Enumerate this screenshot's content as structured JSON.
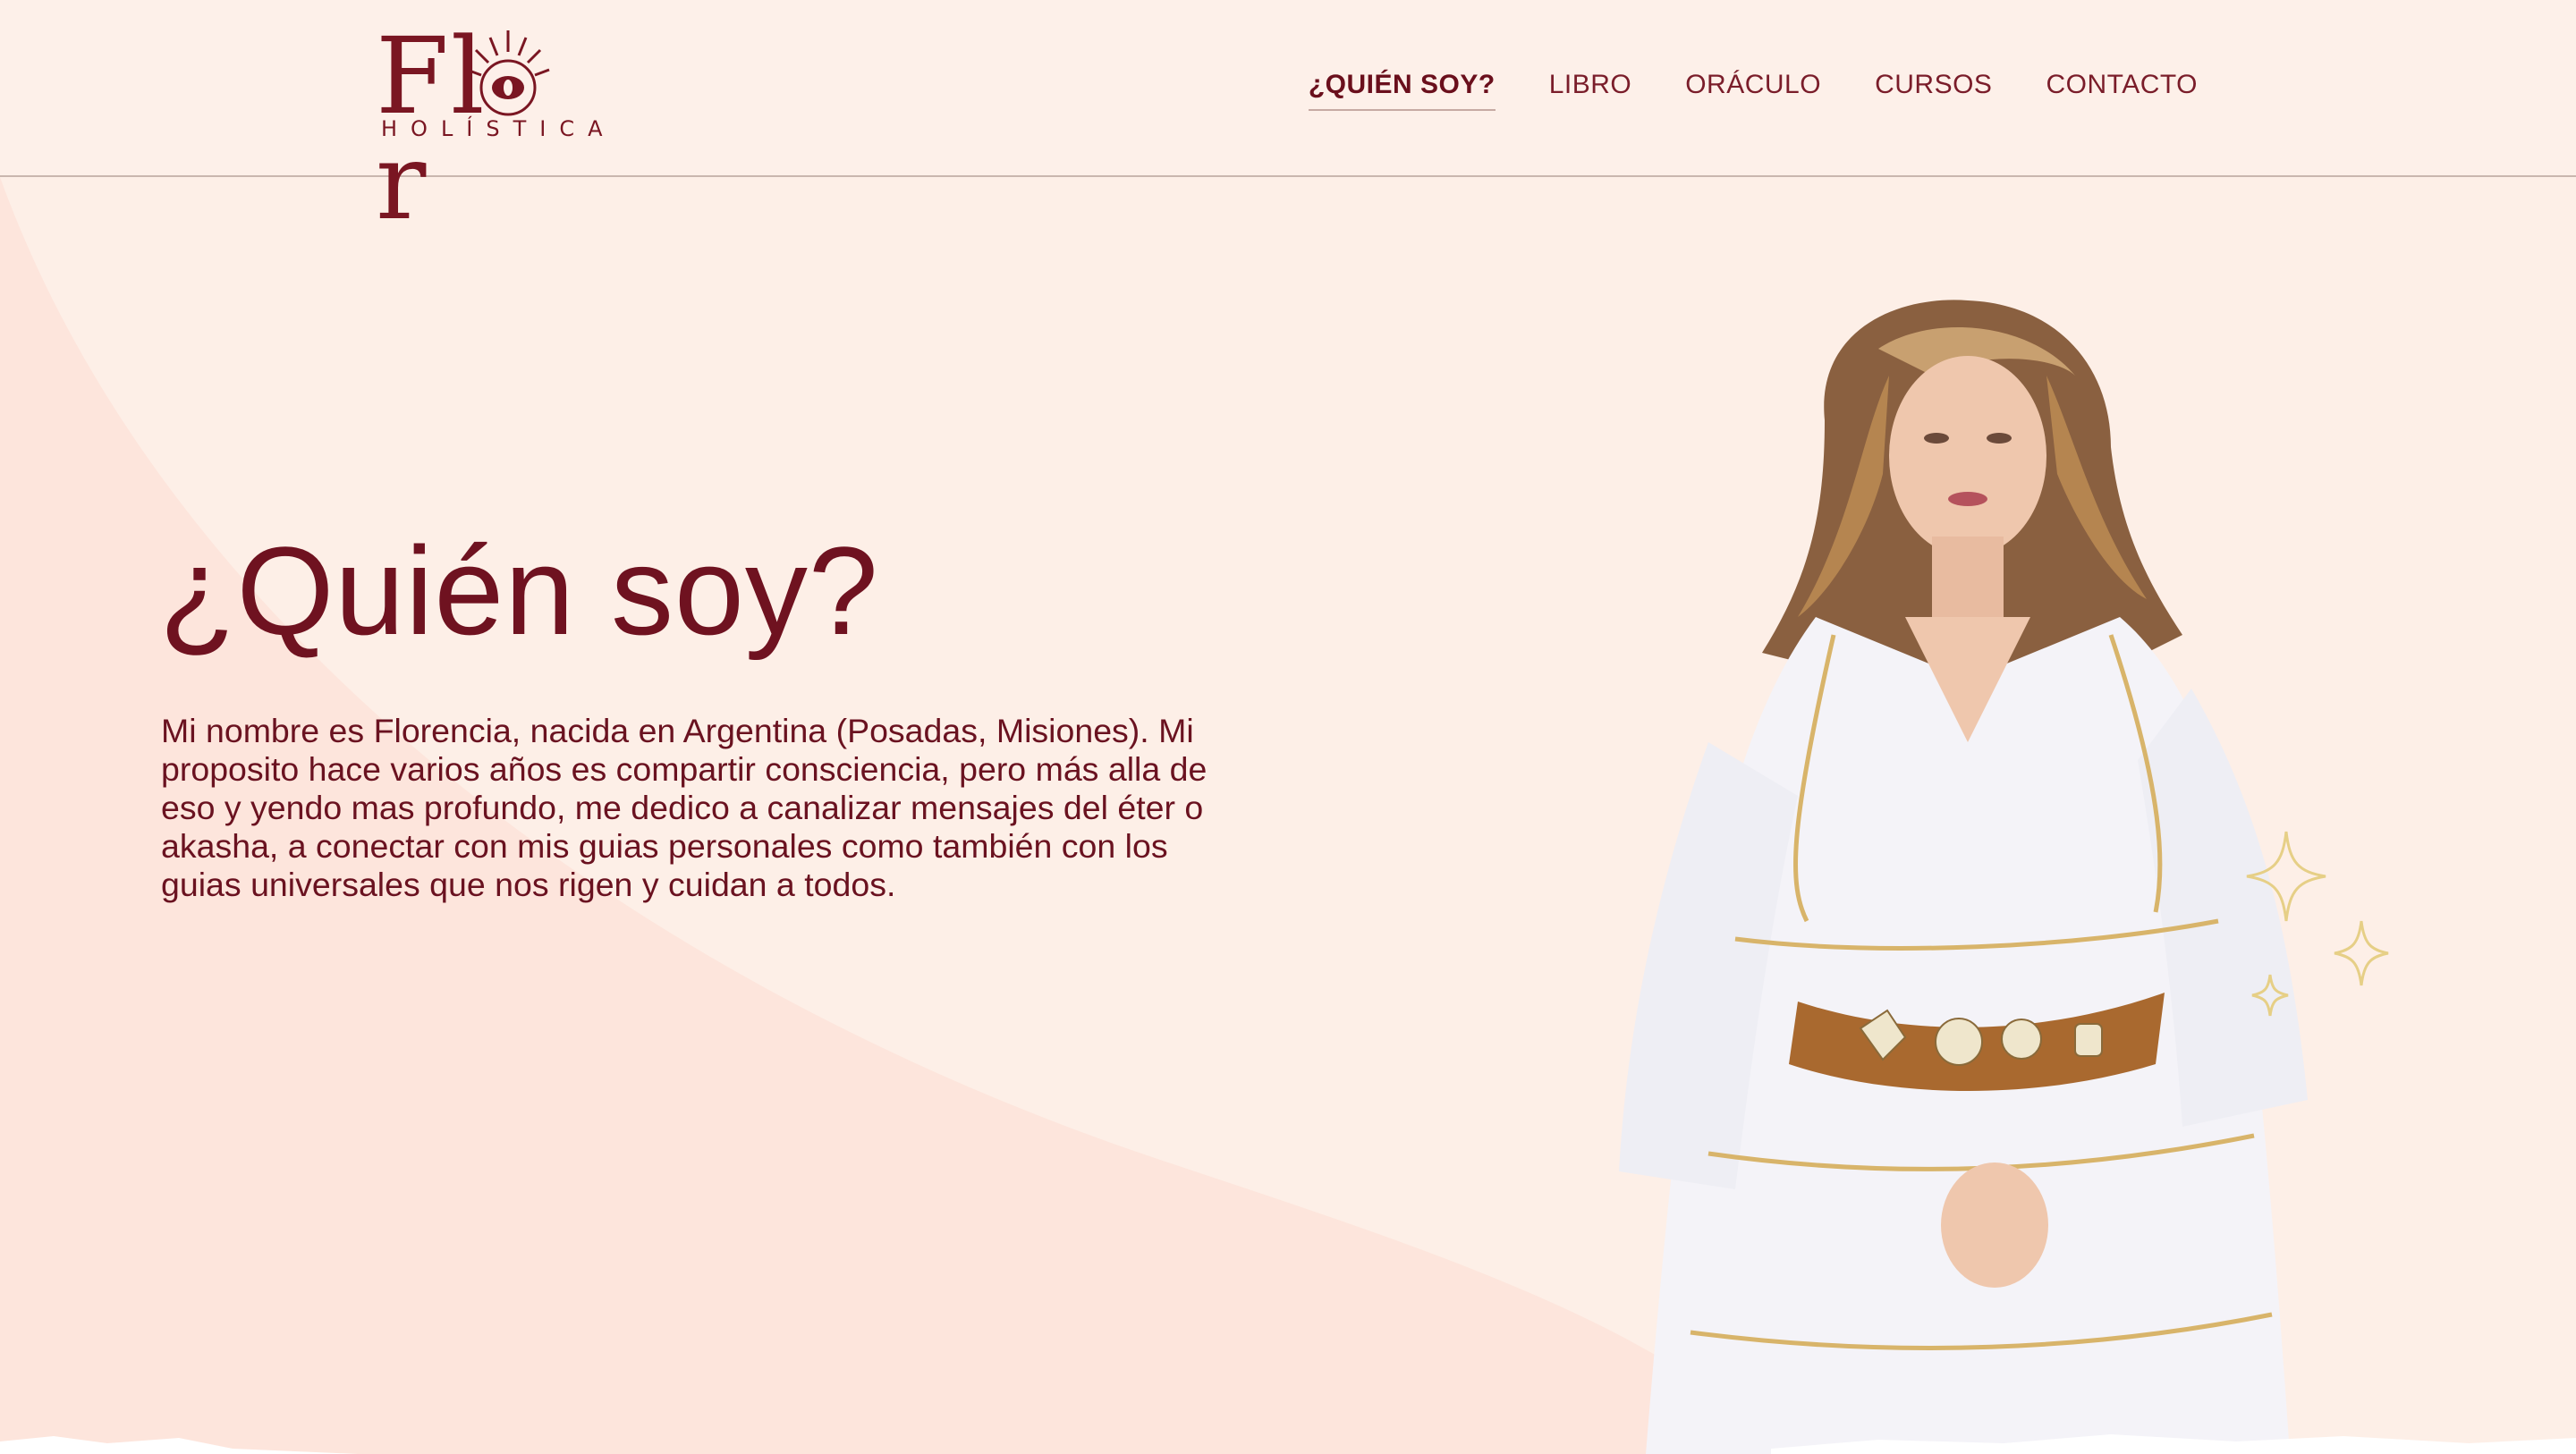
{
  "brand": {
    "logo_word": "Flor",
    "logo_sub": "HOLÍSTICA"
  },
  "nav": {
    "items": [
      {
        "label": "¿QUIÉN SOY?",
        "active": true
      },
      {
        "label": "LIBRO",
        "active": false
      },
      {
        "label": "ORÁCULO",
        "active": false
      },
      {
        "label": "CURSOS",
        "active": false
      },
      {
        "label": "CONTACTO",
        "active": false
      }
    ]
  },
  "hero": {
    "title": "¿Quién soy?",
    "text": "Mi nombre es Florencia, nacida en Argentina (Posadas, Misiones). Mi proposito hace varios años es compartir consciencia, pero más alla de eso y yendo mas profundo, me dedico a canalizar mensajes del éter o akasha, a conectar con mis guias personales como también con los guias universales que nos rigen y cuidan a todos."
  },
  "colors": {
    "accent": "#6f1220",
    "background": "#fdefe7",
    "sparkle": "#e6cf86"
  },
  "icons": {
    "logo_eye": "eye-icon",
    "sparkles": "sparkle-icon"
  }
}
